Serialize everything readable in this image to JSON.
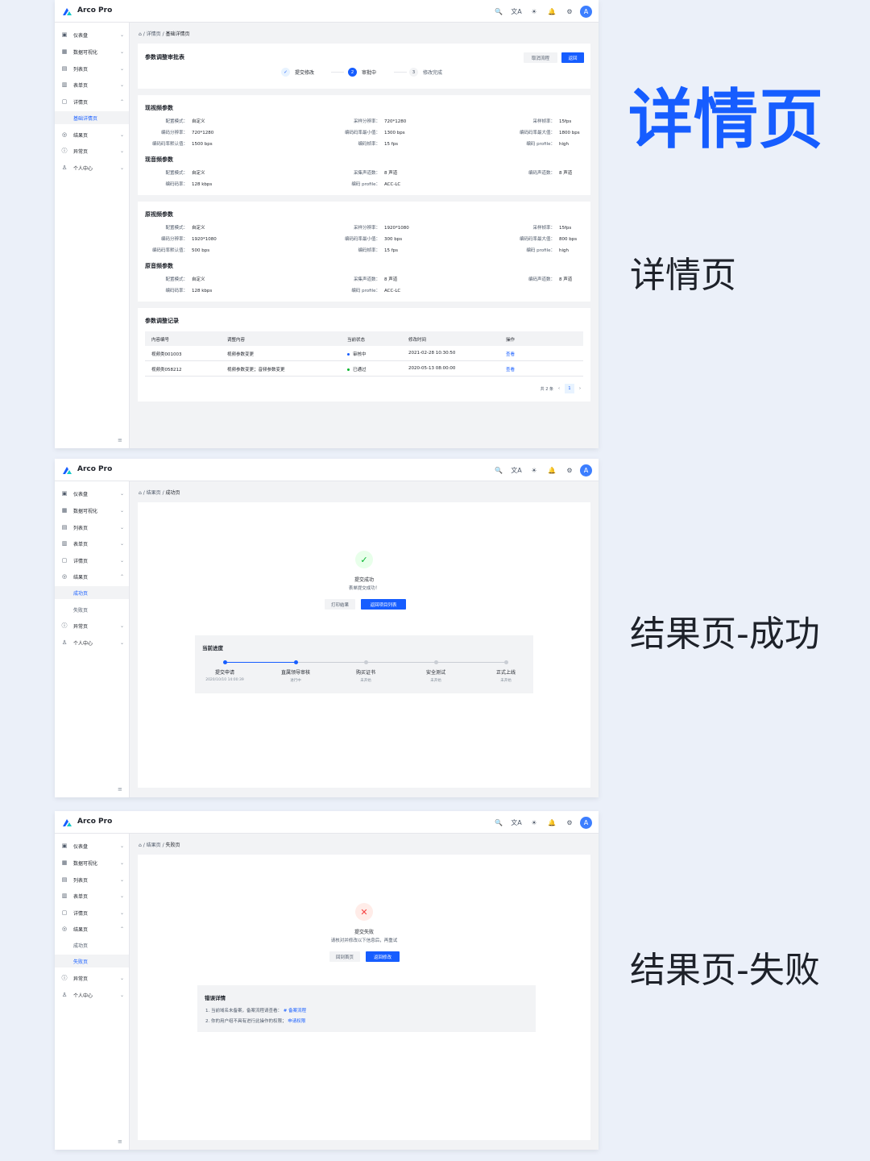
{
  "app": {
    "brand": "Arco Pro",
    "avatar_letter": "A",
    "accent": "#165dff",
    "success": "#00b42a",
    "danger": "#f53f3f"
  },
  "topbar_icons": [
    "search-icon",
    "translate-icon",
    "theme-icon",
    "bell-icon",
    "gear-icon"
  ],
  "icon_glyphs": {
    "search": "🔍",
    "translate": "文A",
    "theme": "☀",
    "bell": "🔔",
    "gear": "⚙"
  },
  "nav": {
    "dashboard": "仪表盘",
    "visualization": "数据可视化",
    "list": "列表页",
    "form": "表单页",
    "detail": "详情页",
    "detail_basic": "基础详情页",
    "result": "结果页",
    "result_success": "成功页",
    "result_error": "失败页",
    "exception": "异常页",
    "user": "个人中心"
  },
  "headings": {
    "main": "详情页",
    "label1": "详情页",
    "label2": "结果页-成功",
    "label3": "结果页-失败"
  },
  "detail": {
    "breadcrumb_parent": "详情页",
    "breadcrumb_current": "基础详情页",
    "approval_title": "参数调整审批表",
    "cancel_btn": "取消流程",
    "back_btn": "返回",
    "steps": [
      {
        "num": "✓",
        "label": "提交修改"
      },
      {
        "num": "2",
        "label": "审批中"
      },
      {
        "num": "3",
        "label": "修改完成"
      }
    ],
    "current_video_title": "现视频参数",
    "current_video": [
      [
        "配置模式：",
        "自定义",
        "采样分辨率：",
        "720*1280",
        "采样帧率：",
        "15fps"
      ],
      [
        "编码分辨率：",
        "720*1280",
        "编码码率最小值：",
        "1300 bps",
        "编码码率最大值：",
        "1800 bps"
      ],
      [
        "编码码率默认值：",
        "1500 bps",
        "编码帧率：",
        "15 fps",
        "编码 profile：",
        "high"
      ]
    ],
    "current_audio_title": "现音频参数",
    "current_audio": [
      [
        "配置模式：",
        "自定义",
        "采集声道数：",
        "8 声道",
        "编码声道数：",
        "8 声道"
      ],
      [
        "编码码率：",
        "128 kbps",
        "编码 profile：",
        "ACC-LC",
        "",
        ""
      ]
    ],
    "orig_video_title": "原视频参数",
    "orig_video": [
      [
        "配置模式：",
        "自定义",
        "采样分辨率：",
        "1920*1080",
        "采样帧率：",
        "15fps"
      ],
      [
        "编码分辨率：",
        "1920*1080",
        "编码码率最小值：",
        "300 bps",
        "编码码率最大值：",
        "800 bps"
      ],
      [
        "编码码率默认值：",
        "500 bps",
        "编码帧率：",
        "15 fps",
        "编码 profile：",
        "high"
      ]
    ],
    "orig_audio_title": "原音频参数",
    "orig_audio": [
      [
        "配置模式：",
        "自定义",
        "采集声道数：",
        "8 声道",
        "编码声道数：",
        "8 声道"
      ],
      [
        "编码码率：",
        "128 kbps",
        "编码 profile：",
        "ACC-LC",
        "",
        ""
      ]
    ],
    "records_title": "参数调整记录",
    "table_headers": [
      "内容编号",
      "调整内容",
      "当前状态",
      "修改时间",
      "操作"
    ],
    "table_rows": [
      {
        "id": "视频类001003",
        "content": "视频参数变更",
        "status": "审核中",
        "status_color": "#165dff",
        "time": "2021-02-28 10:30:50",
        "action": "查看"
      },
      {
        "id": "视频类058212",
        "content": "视频参数变更；音频参数变更",
        "status": "已通过",
        "status_color": "#00b42a",
        "time": "2020-05-13 08:00:00",
        "action": "查看"
      }
    ],
    "pager_total": "共 2 条",
    "pager_page": "1",
    "pager_prev": "‹",
    "pager_next": "›"
  },
  "success": {
    "breadcrumb_parent": "结果页",
    "breadcrumb_current": "成功页",
    "title": "提交成功",
    "subtitle": "表单提交成功！",
    "print_btn": "打印结果",
    "back_btn": "返回项目列表",
    "progress_title": "当前进度",
    "progress_steps": [
      {
        "label": "提交申请",
        "sub": "2020/10/10 14:00:39"
      },
      {
        "label": "直属领导审核",
        "sub": "进行中"
      },
      {
        "label": "购买证书",
        "sub": "未开始"
      },
      {
        "label": "安全测试",
        "sub": "未开始"
      },
      {
        "label": "正式上线",
        "sub": "未开始"
      }
    ]
  },
  "error": {
    "breadcrumb_parent": "结果页",
    "breadcrumb_current": "失败页",
    "title": "提交失败",
    "subtitle": "请核对并修改以下信息后，再重试",
    "home_btn": "回到首页",
    "back_btn": "返回修改",
    "details_title": "错误详情",
    "line1": "1. 当前域名未备案，备案流程请查看：",
    "line1_link": "# 备案流程",
    "line2": "2. 你的用户组不具有进行此操作的权限；",
    "line2_link": "申请权限"
  }
}
